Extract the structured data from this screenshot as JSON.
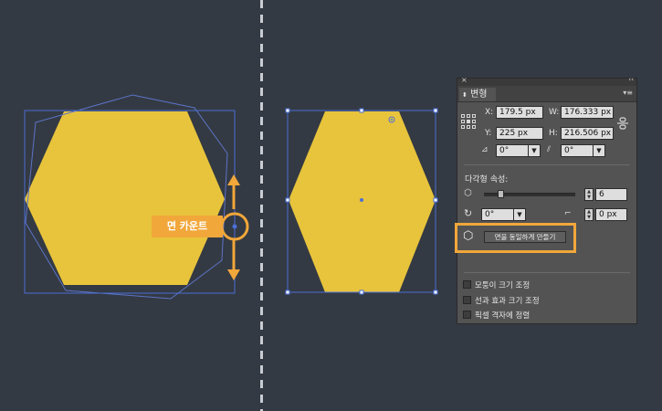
{
  "callout": {
    "label": "면 카운트"
  },
  "panel": {
    "close_glyph": "×",
    "collapse_glyph": "‹‹",
    "tab_label": "변형",
    "x_label": "X:",
    "x_value": "179.5 px",
    "w_label": "W:",
    "w_value": "176.333 px",
    "y_label": "Y:",
    "y_value": "225 px",
    "h_label": "H:",
    "h_value": "216.506 px",
    "rotate_value": "0°",
    "shear_value": "0°",
    "polygon_section_label": "다각형 속성:",
    "side_count": "6",
    "polygon_angle": "0°",
    "corner_radius": "0 px",
    "equalize_button": "면을 동일하게 만들기",
    "options": [
      {
        "label": "모퉁이 크기 조정"
      },
      {
        "label": "선과 효과 크기 조정"
      },
      {
        "label": "픽셀 격자에 정렬"
      }
    ]
  },
  "colors": {
    "background": "#343a43",
    "shape_fill": "#e8c43c",
    "accent": "#f1a73a",
    "selection": "#4a6fd6"
  }
}
